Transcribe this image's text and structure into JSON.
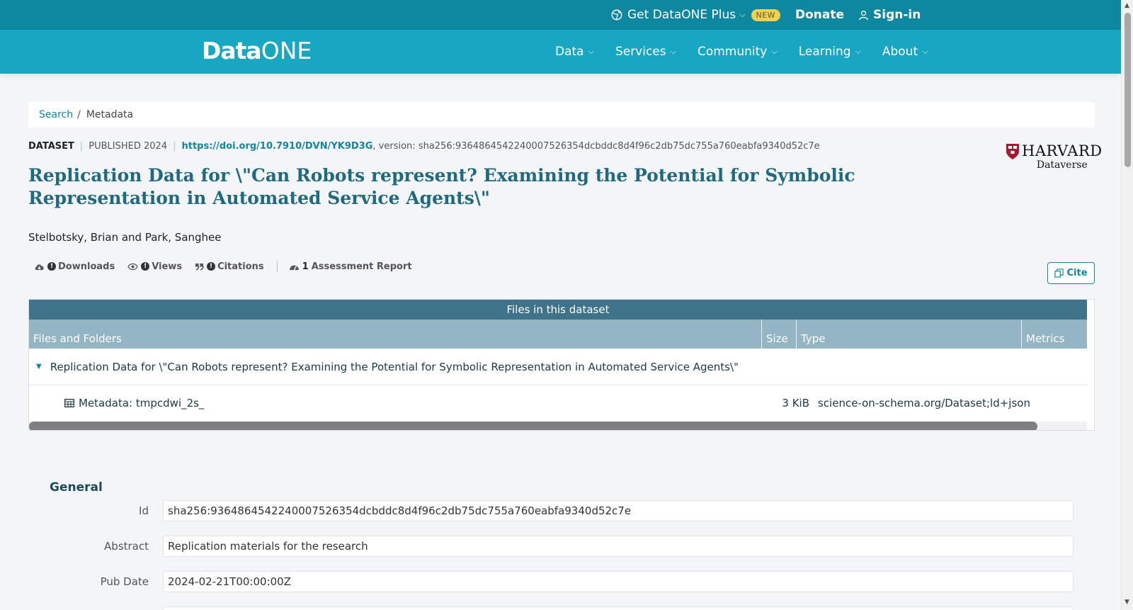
{
  "topbar": {
    "plus_label": "Get DataONE Plus",
    "new_badge": "NEW",
    "donate": "Donate",
    "signin": "Sign-in"
  },
  "logo": {
    "data": "Data",
    "one": "ONE"
  },
  "nav": {
    "items": [
      "Data",
      "Services",
      "Community",
      "Learning",
      "About"
    ]
  },
  "breadcrumb": {
    "search": "Search",
    "sep": "/",
    "current": "Metadata"
  },
  "dataset": {
    "type_label": "DATASET",
    "published": "PUBLISHED 2024",
    "doi": "https://doi.org/10.7910/DVN/YK9D3G",
    "version": ", version: sha256:936486454224000752635​4dcbddc8d4f96c2db75dc755a760eabfa9340d52c7e",
    "title": "Replication Data for \\\"Can Robots represent? Examining the Potential for Symbolic Representation in Automated Service Agents\\\"",
    "authors": "Stelbotsky, Brian and Park, Sanghee"
  },
  "repository": {
    "name": "HARVARD",
    "sub": "Dataverse"
  },
  "metrics": {
    "downloads": "Downloads",
    "views": "Views",
    "citations": "Citations",
    "assessment_count": "1",
    "assessment_label": "Assessment Report",
    "excl": "!"
  },
  "cite_button": "Cite",
  "files": {
    "caption": "Files in this dataset",
    "headers": [
      "Files and Folders",
      "Size",
      "Type",
      "Metrics"
    ],
    "folder": "Replication Data for \\\"Can Robots represent? Examining the Potential for Symbolic Representation in Automated Service Agents\\\"",
    "file_name": "Metadata: tmpcdwi_2s_",
    "file_size": "3 KiB",
    "file_type": "science-on-schema.org/Dataset;ld+json"
  },
  "general": {
    "heading": "General",
    "fields": [
      {
        "label": "Id",
        "value": "sha256:936486454224000752635​4dcbddc8d4f96c2db75dc755a760eabfa9340d52c7e"
      },
      {
        "label": "Abstract",
        "value": "Replication materials for the research"
      },
      {
        "label": "Pub Date",
        "value": "2024-02-21T00:00:00Z"
      },
      {
        "label": "",
        "value": ""
      }
    ]
  },
  "colors": {
    "topbar": "#0e87a0",
    "navbar": "#17a7c2",
    "title": "#1f6a80",
    "table_caption": "#3f7389",
    "table_header": "#93b5c4",
    "badge": "#f3d24b"
  }
}
